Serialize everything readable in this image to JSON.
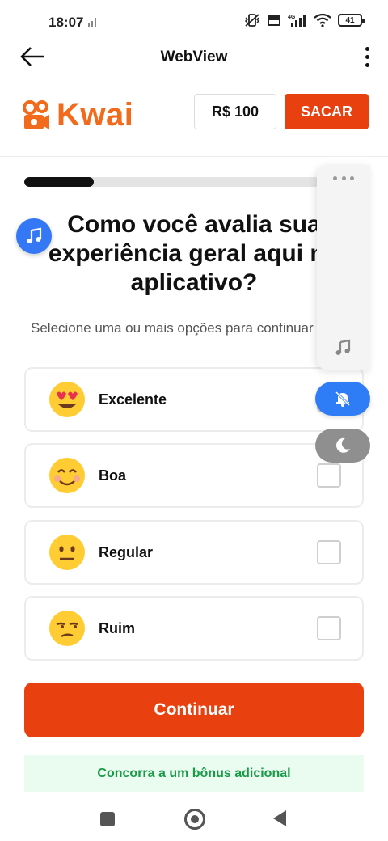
{
  "status_bar": {
    "time": "18:07",
    "battery": "41"
  },
  "topbar": {
    "title": "WebView"
  },
  "header": {
    "brand": "Kwai",
    "balance": "R$ 100",
    "withdraw_label": "SACAR",
    "accent_color": "#e8400e"
  },
  "survey": {
    "progress": 0.22,
    "question": "Como você avalia sua experiência geral aqui no aplicativo?",
    "subtitle": "Selecione uma ou mais opções para continuar",
    "options": [
      {
        "label": "Excelente",
        "icon": "heart-eyes-emoji-icon",
        "checked": false
      },
      {
        "label": "Boa",
        "icon": "smiling-emoji-icon",
        "checked": false
      },
      {
        "label": "Regular",
        "icon": "neutral-emoji-icon",
        "checked": false
      },
      {
        "label": "Ruim",
        "icon": "unamused-emoji-icon",
        "checked": false
      }
    ],
    "continue_label": "Continuar",
    "bonus_text": "Concorra a um bônus adicional"
  }
}
